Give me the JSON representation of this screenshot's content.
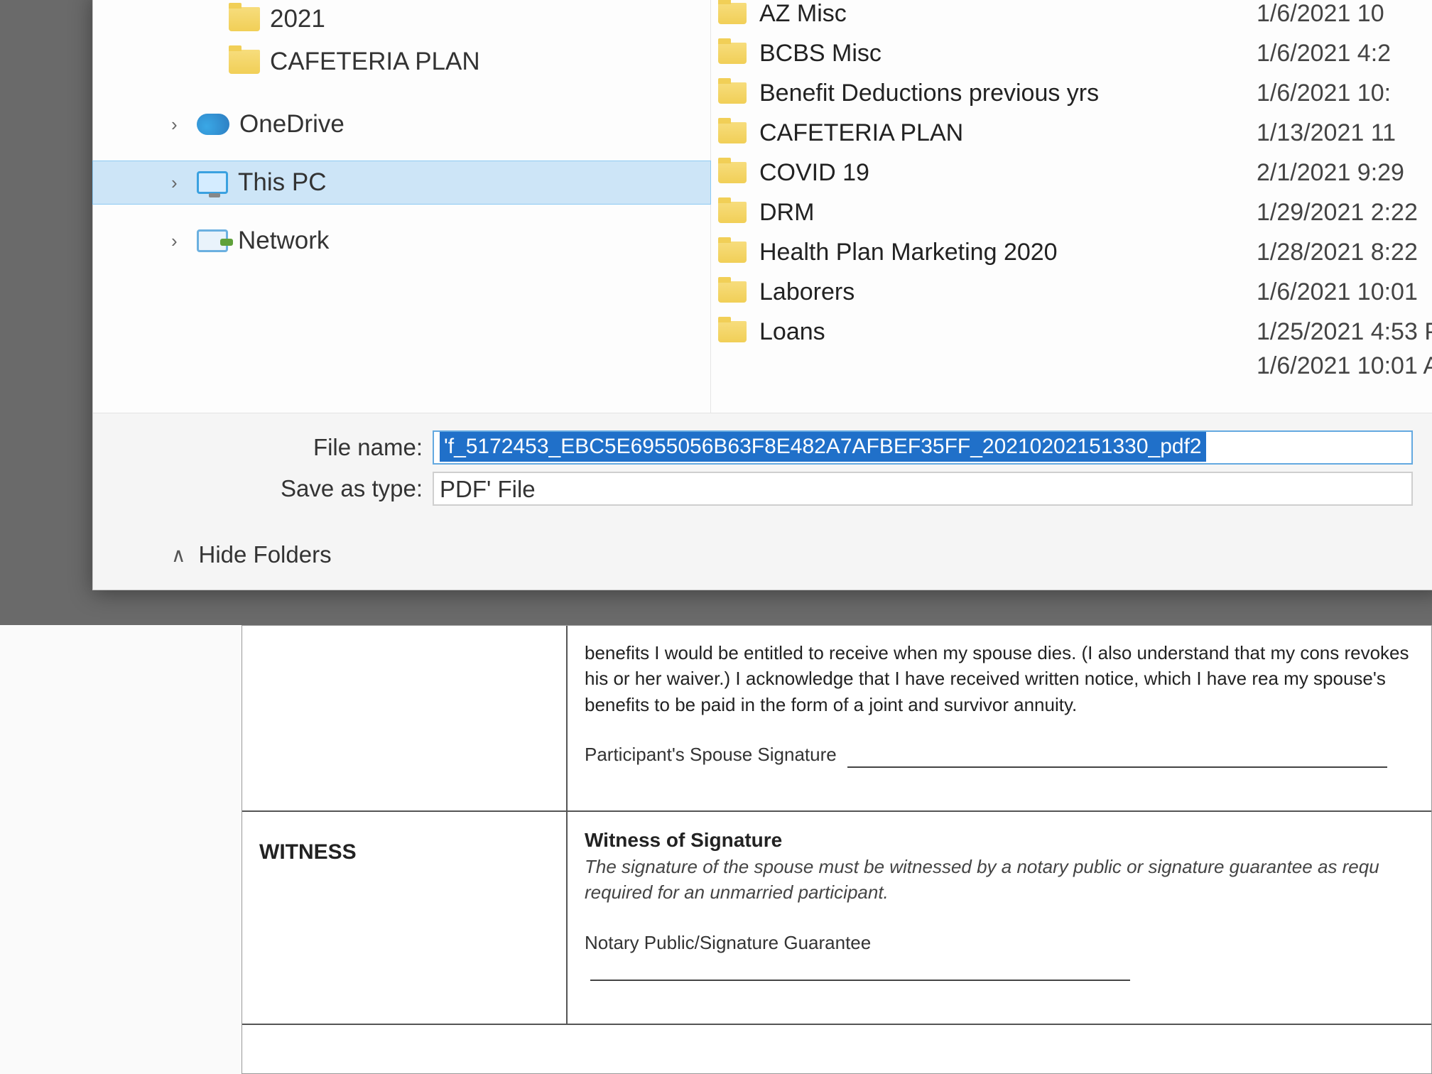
{
  "navpane": {
    "items": [
      {
        "label": "2021"
      },
      {
        "label": "CAFETERIA PLAN"
      },
      {
        "label": "OneDrive"
      },
      {
        "label": "This PC"
      },
      {
        "label": "Network"
      }
    ]
  },
  "filelist": [
    {
      "name": "AZ Misc",
      "date": "1/6/2021 10"
    },
    {
      "name": "BCBS Misc",
      "date": "1/6/2021 4:2"
    },
    {
      "name": "Benefit Deductions previous yrs",
      "date": "1/6/2021 10:"
    },
    {
      "name": "CAFETERIA PLAN",
      "date": "1/13/2021 11"
    },
    {
      "name": "COVID 19",
      "date": "2/1/2021 9:29"
    },
    {
      "name": "DRM",
      "date": "1/29/2021 2:22"
    },
    {
      "name": "Health Plan Marketing 2020",
      "date": "1/28/2021 8:22"
    },
    {
      "name": "Laborers",
      "date": "1/6/2021 10:01"
    },
    {
      "name": "Loans",
      "date": "1/25/2021 4:53 P"
    },
    {
      "name": "",
      "date": "1/6/2021 10:01 A"
    }
  ],
  "filename_label": "File name:",
  "filename_value": "'f_5172453_EBC5E6955056B63F8E482A7AFBEF35FF_20210202151330_pdf2",
  "savetype_label": "Save as type:",
  "savetype_value": "PDF' File",
  "hide_folders": "Hide Folders",
  "doc": {
    "spouse_para": "benefits I would be entitled to receive when my spouse dies. (I also understand that my cons revokes his or her waiver.) I acknowledge that I have received written notice, which I have rea my spouse's benefits to be paid in the form of a joint and survivor annuity.",
    "spouse_sig_label": "Participant's Spouse Signature",
    "witness_heading": "WITNESS",
    "witness_title": "Witness of Signature",
    "witness_para": "The signature of the spouse must be witnessed by a notary public or signature guarantee as requ required for an unmarried participant.",
    "notary_label": "Notary Public/Signature Guarantee"
  }
}
